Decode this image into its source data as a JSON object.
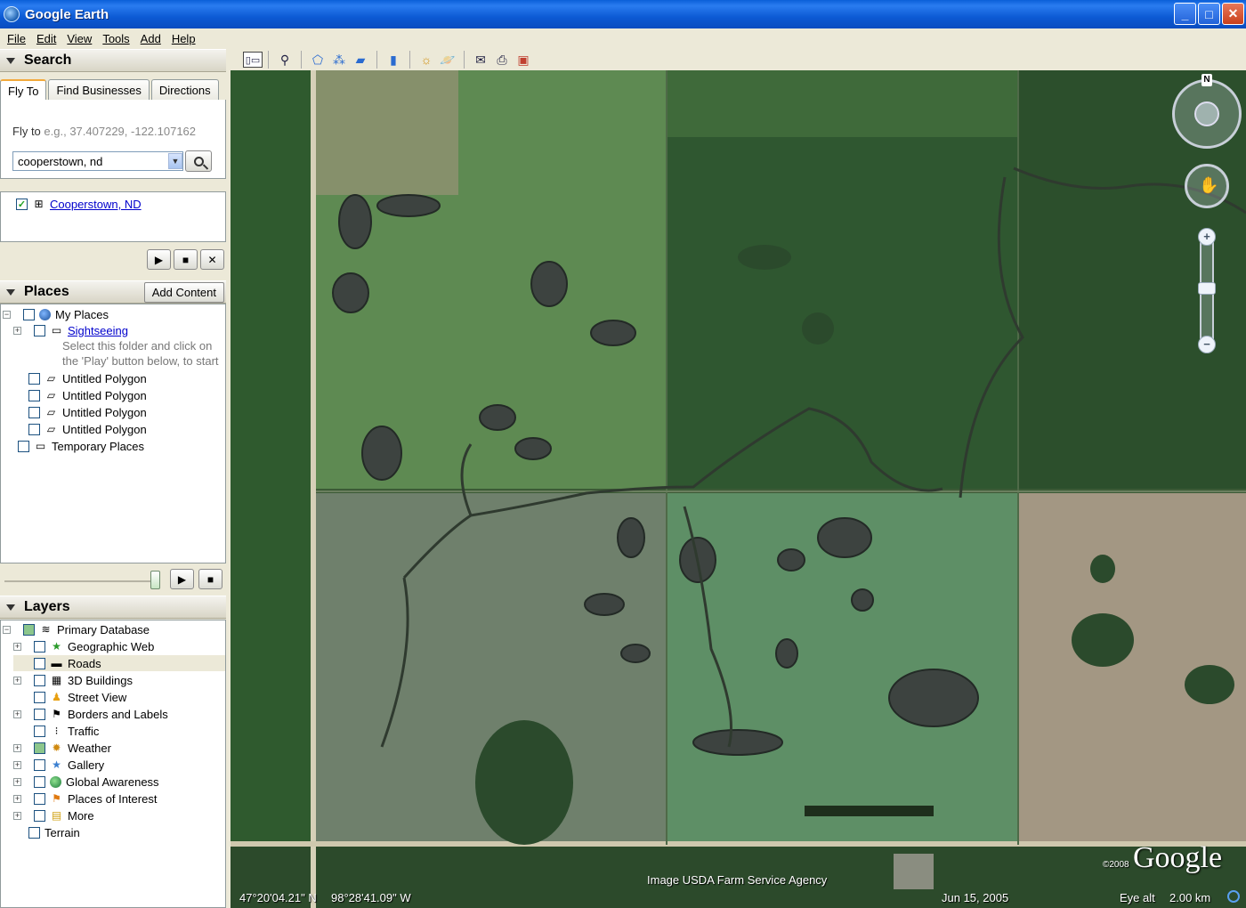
{
  "window": {
    "title": "Google Earth",
    "minimize": "_",
    "maximize": "□",
    "close": "✕"
  },
  "menu": [
    "File",
    "Edit",
    "View",
    "Tools",
    "Add",
    "Help"
  ],
  "search": {
    "header": "Search",
    "tabs": [
      "Fly To",
      "Find Businesses",
      "Directions"
    ],
    "flyto_label": "Fly to",
    "flyto_example": "e.g., 37.407229, -122.107162",
    "query": "cooperstown, nd",
    "result": "Cooperstown, ND"
  },
  "places": {
    "header": "Places",
    "add_content": "Add Content",
    "items": [
      {
        "label": "My Places"
      },
      {
        "label": "Sightseeing"
      },
      {
        "label": "Select this folder and click on"
      },
      {
        "label": "the 'Play' button below, to start"
      },
      {
        "label": "Untitled Polygon"
      },
      {
        "label": "Untitled Polygon"
      },
      {
        "label": "Untitled Polygon"
      },
      {
        "label": "Untitled Polygon"
      },
      {
        "label": "Temporary Places"
      }
    ]
  },
  "layers": {
    "header": "Layers",
    "items": [
      {
        "label": "Primary Database"
      },
      {
        "label": "Geographic Web"
      },
      {
        "label": "Roads"
      },
      {
        "label": "3D Buildings"
      },
      {
        "label": "Street View"
      },
      {
        "label": "Borders and Labels"
      },
      {
        "label": "Traffic"
      },
      {
        "label": "Weather"
      },
      {
        "label": "Gallery"
      },
      {
        "label": "Global Awareness"
      },
      {
        "label": "Places of Interest"
      },
      {
        "label": "More"
      },
      {
        "label": "Terrain"
      }
    ]
  },
  "map": {
    "compass_n": "N",
    "credit": "Image USDA Farm Service Agency",
    "copyright_year": "©2008",
    "logo": "Google",
    "latitude": "47°20'04.21\" N",
    "longitude": "98°28'41.09\" W",
    "date": "Jun 15, 2005",
    "eye_alt_label": "Eye alt",
    "eye_alt_value": "2.00 km"
  }
}
